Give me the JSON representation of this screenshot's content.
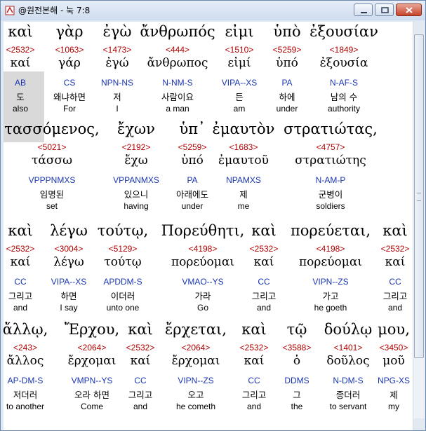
{
  "window": {
    "title": "@원전본해 - 눅 7:8",
    "app_icon": "bible-app-icon",
    "buttons": [
      "minimize-icon",
      "maximize-icon",
      "close-icon"
    ]
  },
  "verse": {
    "lines": [
      {
        "words": [
          {
            "greek": "καὶ",
            "strong": "<2532>",
            "lemma": "καί",
            "parsing": "AB",
            "korean": "도",
            "english": "also"
          },
          {
            "greek": "γὰρ",
            "strong": "<1063>",
            "lemma": "γάρ",
            "parsing": "CS",
            "korean": "왜냐하면",
            "english": "For"
          },
          {
            "greek": "ἐγὼ",
            "strong": "<1473>",
            "lemma": "ἐγώ",
            "parsing": "NPN-NS",
            "korean": "저",
            "english": "I"
          },
          {
            "greek": "ἄνθρωπός",
            "strong": "<444>",
            "lemma": "ἄνθρωπος",
            "parsing": "N-NM-S",
            "korean": "사람이요",
            "english": "a man"
          },
          {
            "greek": "εἰμι",
            "strong": "<1510>",
            "lemma": "εἰμί",
            "parsing": "VIPA--XS",
            "korean": "든",
            "english": "am"
          },
          {
            "greek": "ὑπὸ",
            "strong": "<5259>",
            "lemma": "ὑπό",
            "parsing": "PA",
            "korean": "하에",
            "english": "under"
          },
          {
            "greek": "ἐξουσίαν",
            "strong": "<1849>",
            "lemma": "ἐξουσία",
            "parsing": "N-AF-S",
            "korean": "남의 수",
            "english": "authority"
          }
        ]
      },
      {
        "words": [
          {
            "greek": "τασσόμενος,",
            "strong": "<5021>",
            "lemma": "τάσσω",
            "parsing": "VPPPNMXS",
            "korean": "임명된",
            "english": "set"
          },
          {
            "greek": "ἔχων",
            "strong": "<2192>",
            "lemma": "ἔχω",
            "parsing": "VPPANMXS",
            "korean": "있으니",
            "english": "having"
          },
          {
            "greek": "ὑπ᾽",
            "strong": "<5259>",
            "lemma": "ὑπό",
            "parsing": "PA",
            "korean": "아래에도",
            "english": "under"
          },
          {
            "greek": "ἐμαυτὸν",
            "strong": "<1683>",
            "lemma": "ἐμαυτοῦ",
            "parsing": "NPAMXS",
            "korean": "제",
            "english": "me"
          },
          {
            "greek": "στρατιώτας,",
            "strong": "<4757>",
            "lemma": "στρατιώτης",
            "parsing": "N-AM-P",
            "korean": "군병이",
            "english": "soldiers"
          }
        ]
      },
      {
        "words": [
          {
            "greek": "καὶ",
            "strong": "<2532>",
            "lemma": "καί",
            "parsing": "CC",
            "korean": "그리고",
            "english": "and"
          },
          {
            "greek": "λέγω",
            "strong": "<3004>",
            "lemma": "λέγω",
            "parsing": "VIPA--XS",
            "korean": "하면",
            "english": "I say"
          },
          {
            "greek": "τούτῳ,",
            "strong": "<5129>",
            "lemma": "τούτῳ",
            "parsing": "APDDM-S",
            "korean": "이더러",
            "english": "unto one"
          },
          {
            "greek": "Πορεύθητι,",
            "strong": "<4198>",
            "lemma": "πορεύομαι",
            "parsing": "VMAO--YS",
            "korean": "가라",
            "english": "Go"
          },
          {
            "greek": "καὶ",
            "strong": "<2532>",
            "lemma": "καί",
            "parsing": "CC",
            "korean": "그리고",
            "english": "and"
          },
          {
            "greek": "πορεύεται,",
            "strong": "<4198>",
            "lemma": "πορεύομαι",
            "parsing": "VIPN--ZS",
            "korean": "가고",
            "english": "he goeth"
          },
          {
            "greek": "καὶ",
            "strong": "<2532>",
            "lemma": "καί",
            "parsing": "CC",
            "korean": "그리고",
            "english": "and"
          }
        ]
      },
      {
        "words": [
          {
            "greek": "ἄλλῳ,",
            "strong": "<243>",
            "lemma": "ἄλλος",
            "parsing": "AP-DM-S",
            "korean": "저더러",
            "english": "to another"
          },
          {
            "greek": "Ἔρχου,",
            "strong": "<2064>",
            "lemma": "ἔρχομαι",
            "parsing": "VMPN--YS",
            "korean": "오라 하면",
            "english": "Come"
          },
          {
            "greek": "καὶ",
            "strong": "<2532>",
            "lemma": "καί",
            "parsing": "CC",
            "korean": "그리고",
            "english": "and"
          },
          {
            "greek": "ἔρχεται,",
            "strong": "<2064>",
            "lemma": "ἔρχομαι",
            "parsing": "VIPN--ZS",
            "korean": "오고",
            "english": "he cometh"
          },
          {
            "greek": "καὶ",
            "strong": "<2532>",
            "lemma": "καί",
            "parsing": "CC",
            "korean": "그리고",
            "english": "and"
          },
          {
            "greek": "τῷ",
            "strong": "<3588>",
            "lemma": "ὁ",
            "parsing": "DDMS",
            "korean": "그",
            "english": "the"
          },
          {
            "greek": "δούλῳ",
            "strong": "<1401>",
            "lemma": "δοῦλος",
            "parsing": "N-DM-S",
            "korean": "종더러",
            "english": "to servant"
          },
          {
            "greek": "μου,",
            "strong": "<3450>",
            "lemma": "μοῦ",
            "parsing": "NPG-XS",
            "korean": "제",
            "english": "my"
          }
        ]
      }
    ]
  },
  "scrollbar": {
    "position_fraction": 0.0
  }
}
